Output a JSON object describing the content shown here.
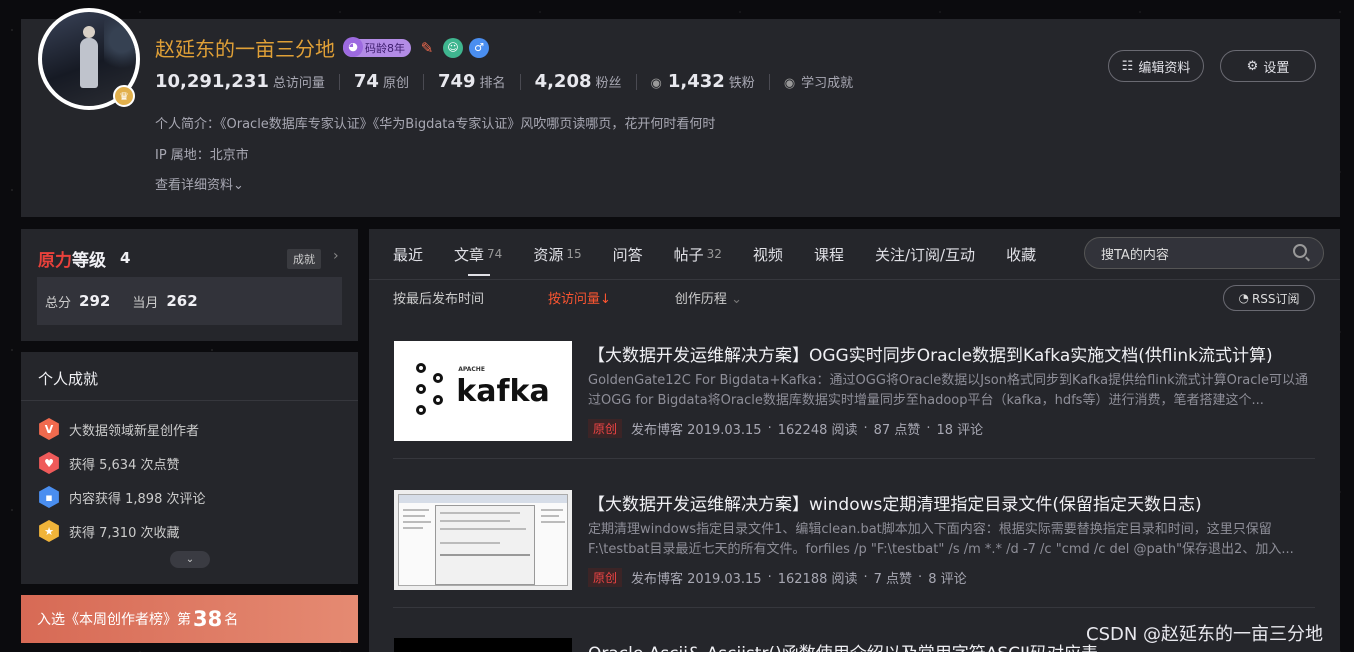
{
  "profile": {
    "name": "赵延东的一亩三分地",
    "age_badge": "码龄8年",
    "stats": [
      {
        "value": "10,291,231",
        "label": "总访问量"
      },
      {
        "value": "74",
        "label": "原创"
      },
      {
        "value": "749",
        "label": "排名"
      },
      {
        "value": "4,208",
        "label": "粉丝"
      },
      {
        "value": "1,432",
        "label": "铁粉"
      }
    ],
    "study_label": "学习成就",
    "intro": "个人简介：《Oracle数据库专家认证》《华为Bigdata专家认证》风吹哪页读哪页，花开何时看何时",
    "ip": "IP 属地：北京市",
    "more_label": "查看详细资料",
    "edit_label": "编辑资料",
    "settings_label": "设置"
  },
  "level": {
    "title_red": "原力",
    "title_rest": "等级",
    "value": "4",
    "tag": "成就",
    "total_label": "总分",
    "total_value": "292",
    "month_label": "当月",
    "month_value": "262"
  },
  "achievements": {
    "title": "个人成就",
    "items": [
      {
        "icon": "V",
        "text": "大数据领域新星创作者",
        "color": "#f06a4e"
      },
      {
        "icon": "♥",
        "text": "获得 5,634 次点赞",
        "color": "#ef5a5a"
      },
      {
        "icon": "▪",
        "text": "内容获得 1,898 次评论",
        "color": "#4a8ef0"
      },
      {
        "icon": "★",
        "text": "获得 7,310 次收藏",
        "color": "#f0b43a"
      }
    ]
  },
  "rank": {
    "prefix": "入选《本周创作者榜》第",
    "number": "38",
    "suffix": "名"
  },
  "tabs": [
    {
      "label": "最近",
      "count": ""
    },
    {
      "label": "文章",
      "count": "74"
    },
    {
      "label": "资源",
      "count": "15"
    },
    {
      "label": "问答",
      "count": ""
    },
    {
      "label": "帖子",
      "count": "32"
    },
    {
      "label": "视频",
      "count": ""
    },
    {
      "label": "课程",
      "count": ""
    },
    {
      "label": "关注/订阅/互动",
      "count": ""
    },
    {
      "label": "收藏",
      "count": ""
    }
  ],
  "search_placeholder": "搜TA的内容",
  "sort": {
    "by_time": "按最后发布时间",
    "by_views": "按访问量↓",
    "history": "创作历程"
  },
  "rss_label": "RSS订阅",
  "kafka_logo": {
    "apache": "APACHE",
    "word": "kafka"
  },
  "articles": [
    {
      "title": "【大数据开发运维解决方案】OGG实时同步Oracle数据到Kafka实施文档(供flink流式计算)",
      "desc": "GoldenGate12C For Bigdata+Kafka：通过OGG将Oracle数据以Json格式同步到Kafka提供给flink流式计算Oracle可以通过OGG for Bigdata将Oracle数据库数据实时增量同步至hadoop平台（kafka，hdfs等）进行消费，笔者搭建这个...",
      "tag": "原创",
      "date": "发布博客 2019.03.15",
      "views": "162248 阅读",
      "likes": "87 点赞",
      "comments": "18 评论"
    },
    {
      "title": "【大数据开发运维解决方案】windows定期清理指定目录文件(保留指定天数日志)",
      "desc": "定期清理windows指定目录文件1、编辑clean.bat脚本加入下面内容：根据实际需要替换指定目录和时间，这里只保留F:\\testbat目录最近七天的所有文件。forfiles /p \"F:\\testbat\" /s /m *.* /d -7 /c \"cmd /c del @path\"保存退出2、加入...",
      "tag": "原创",
      "date": "发布博客 2019.03.15",
      "views": "162188 阅读",
      "likes": "7 点赞",
      "comments": "8 评论"
    },
    {
      "title": "Oracle Ascii& Asciistr()函数使用介绍以及常用字符ASCII码对应表"
    }
  ],
  "watermark": "CSDN @赵延东的一亩三分地"
}
